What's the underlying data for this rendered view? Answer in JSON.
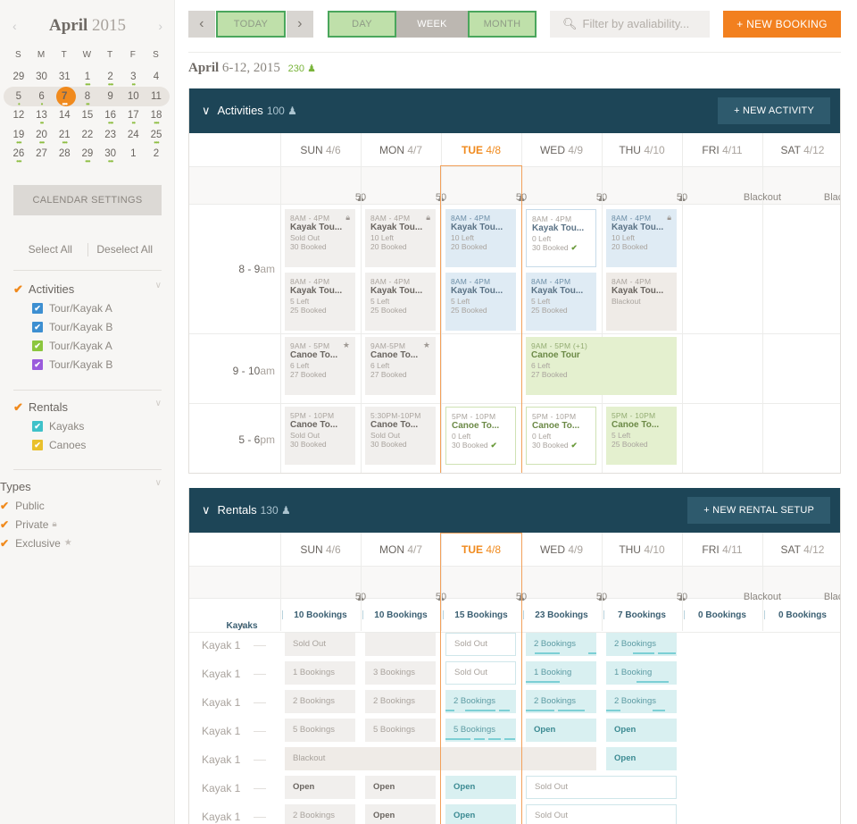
{
  "sidebar": {
    "calendar": {
      "month": "April",
      "year": "2015",
      "dow": [
        "S",
        "M",
        "T",
        "W",
        "T",
        "F",
        "S"
      ],
      "weeks": [
        [
          {
            "d": "29",
            "dim": true
          },
          {
            "d": "30",
            "dim": true
          },
          {
            "d": "31",
            "dim": true
          },
          {
            "d": "1",
            "dots": "•••"
          },
          {
            "d": "2",
            "dots": "•••"
          },
          {
            "d": "3",
            "dots": "••"
          },
          {
            "d": "4"
          }
        ],
        [
          {
            "d": "5",
            "dots": "•"
          },
          {
            "d": "6",
            "dots": "•"
          },
          {
            "d": "7",
            "today": true,
            "dots": "•••"
          },
          {
            "d": "8",
            "dots": "••"
          },
          {
            "d": "9",
            "dim": true
          },
          {
            "d": "10",
            "dim": true
          },
          {
            "d": "11",
            "dim": true
          }
        ],
        [
          {
            "d": "12"
          },
          {
            "d": "13",
            "dots": "••"
          },
          {
            "d": "14"
          },
          {
            "d": "15"
          },
          {
            "d": "16",
            "dots": "•••"
          },
          {
            "d": "17",
            "dots": "••"
          },
          {
            "d": "18",
            "dots": "•••"
          }
        ],
        [
          {
            "d": "19",
            "dots": "•••"
          },
          {
            "d": "20",
            "dots": "•••"
          },
          {
            "d": "21",
            "dots": "•••"
          },
          {
            "d": "22"
          },
          {
            "d": "23"
          },
          {
            "d": "24"
          },
          {
            "d": "25",
            "dots": "•••"
          }
        ],
        [
          {
            "d": "26",
            "dots": "•••"
          },
          {
            "d": "27"
          },
          {
            "d": "28"
          },
          {
            "d": "29",
            "dots": "•••"
          },
          {
            "d": "30",
            "dots": "•••"
          },
          {
            "d": "1",
            "dim": true
          },
          {
            "d": "2",
            "dim": true
          }
        ]
      ]
    },
    "settings_label": "CALENDAR SETTINGS",
    "select_all": "Select All",
    "deselect_all": "Deselect All",
    "groups": {
      "activities": {
        "label": "Activities",
        "items": [
          {
            "label": "Tour/Kayak A",
            "color": "#3d8fd1"
          },
          {
            "label": "Tour/Kayak B",
            "color": "#3d8fd1"
          },
          {
            "label": "Tour/Kayak A",
            "color": "#8cc63e"
          },
          {
            "label": "Tour/Kayak B",
            "color": "#9a5bdc"
          }
        ]
      },
      "rentals": {
        "label": "Rentals",
        "items": [
          {
            "label": "Kayaks",
            "color": "#3fc1c9"
          },
          {
            "label": "Canoes",
            "color": "#e9c02c"
          }
        ]
      },
      "types": {
        "label": "Types",
        "items": [
          {
            "label": "Public",
            "icon": ""
          },
          {
            "label": "Private",
            "icon": "lock-icon"
          },
          {
            "label": "Exclusive",
            "icon": "star-icon"
          }
        ]
      }
    }
  },
  "toolbar": {
    "today": "TODAY",
    "day": "DAY",
    "week": "WEEK",
    "month": "MONTH",
    "filter_placeholder": "Filter by avaliability...",
    "new_booking": "+ NEW BOOKING"
  },
  "range": {
    "month": "April",
    "days": "6-12, 2015",
    "count": "230"
  },
  "days": [
    {
      "dow": "SUN",
      "date": "4/6"
    },
    {
      "dow": "MON",
      "date": "4/7"
    },
    {
      "dow": "TUE",
      "date": "4/8"
    },
    {
      "dow": "WED",
      "date": "4/9"
    },
    {
      "dow": "THU",
      "date": "4/10"
    },
    {
      "dow": "FRI",
      "date": "4/11"
    },
    {
      "dow": "SAT",
      "date": "4/12"
    }
  ],
  "activities": {
    "title": "Activities",
    "count": "100",
    "button": "+ NEW ACTIVITY",
    "capacity": [
      "50",
      "50",
      "50",
      "50",
      "50",
      "Blackout",
      "Blackout"
    ],
    "times": [
      {
        "bold": "8 - 9",
        "suffix": "am"
      },
      {
        "bold": "9 - 10",
        "suffix": "am"
      },
      {
        "bold": "5 - 6",
        "suffix": "pm"
      }
    ],
    "cards": [
      {
        "col": 0,
        "row": 0,
        "style": "grey",
        "time": "8AM - 4PM",
        "name": "Kayak Tou...",
        "l1": "Sold Out",
        "l2": "30 Booked",
        "icon": "lock"
      },
      {
        "col": 1,
        "row": 0,
        "style": "grey",
        "time": "8AM - 4PM",
        "name": "Kayak Tou...",
        "l1": "10 Left",
        "l2": "20 Booked",
        "icon": "lock"
      },
      {
        "col": 2,
        "row": 0,
        "style": "blue",
        "time": "8AM - 4PM",
        "name": "Kayak Tou...",
        "l1": "10 Left",
        "l2": "20 Booked"
      },
      {
        "col": 3,
        "row": 0,
        "style": "bluebd",
        "time": "8AM - 4PM",
        "name": "Kayak Tou...",
        "l1": "0 Left",
        "l2": "30 Booked",
        "check": true
      },
      {
        "col": 4,
        "row": 0,
        "style": "blue",
        "time": "8AM - 4PM",
        "name": "Kayak Tou...",
        "l1": "10 Left",
        "l2": "20 Booked",
        "icon": "lock"
      },
      {
        "col": 0,
        "row": 1,
        "style": "grey",
        "time": "8AM - 4PM",
        "name": "Kayak Tou...",
        "l1": "5 Left",
        "l2": "25 Booked"
      },
      {
        "col": 1,
        "row": 1,
        "style": "grey",
        "time": "8AM - 4PM",
        "name": "Kayak Tou...",
        "l1": "5 Left",
        "l2": "25 Booked"
      },
      {
        "col": 2,
        "row": 1,
        "style": "blue",
        "time": "8AM - 4PM",
        "name": "Kayak Tou...",
        "l1": "5 Left",
        "l2": "25 Booked"
      },
      {
        "col": 3,
        "row": 1,
        "style": "blue",
        "time": "8AM - 4PM",
        "name": "Kayak Tou...",
        "l1": "5 Left",
        "l2": "25 Booked"
      },
      {
        "col": 4,
        "row": 1,
        "style": "beige",
        "time": "8AM - 4PM",
        "name": "Kayak Tou...",
        "l1": "Blackout",
        "l2": ""
      },
      {
        "col": 0,
        "row": 2,
        "style": "grey",
        "time": "9AM - 5PM",
        "name": "Canoe To...",
        "l1": "6 Left",
        "l2": "27 Booked",
        "icon": "star"
      },
      {
        "col": 1,
        "row": 2,
        "style": "grey",
        "time": "9AM-5PM",
        "name": "Canoe To...",
        "l1": "6 Left",
        "l2": "27 Booked",
        "icon": "star"
      },
      {
        "col": 3,
        "row": 2,
        "style": "green",
        "span": 2,
        "time": "9AM - 5PM (+1)",
        "name": "Canoe Tour",
        "l1": "6 Left",
        "l2": "27 Booked"
      },
      {
        "col": 0,
        "row": 3,
        "style": "grey",
        "time": "5PM - 10PM",
        "name": "Canoe To...",
        "l1": "Sold Out",
        "l2": "30 Booked"
      },
      {
        "col": 1,
        "row": 3,
        "style": "grey",
        "time": "5:30PM-10PM",
        "name": "Canoe To...",
        "l1": "Sold Out",
        "l2": "30 Booked"
      },
      {
        "col": 2,
        "row": 3,
        "style": "greenbd",
        "time": "5PM - 10PM",
        "name": "Canoe To...",
        "l1": "0 Left",
        "l2": "30 Booked",
        "check": true
      },
      {
        "col": 3,
        "row": 3,
        "style": "greenbd",
        "time": "5PM - 10PM",
        "name": "Canoe To...",
        "l1": "0 Left",
        "l2": "30 Booked",
        "check": true
      },
      {
        "col": 4,
        "row": 3,
        "style": "green",
        "time": "5PM - 10PM",
        "name": "Canoe To...",
        "l1": "5 Left",
        "l2": "25 Booked"
      }
    ]
  },
  "rentals": {
    "title": "Rentals",
    "count": "130",
    "button": "+ NEW RENTAL SETUP",
    "capacity": [
      "50",
      "50",
      "50",
      "50",
      "50",
      "Blackout",
      "Blackout"
    ],
    "group_label": "Kayaks",
    "summary": [
      "10 Bookings",
      "10 Bookings",
      "15 Bookings",
      "23 Bookings",
      "7 Bookings",
      "0 Bookings",
      "0 Bookings"
    ],
    "rows": [
      {
        "label": "Kayak 1",
        "cells": [
          {
            "col": 0,
            "s": "g",
            "t": "Sold Out"
          },
          {
            "col": 1,
            "s": "g",
            "t": ""
          },
          {
            "col": 2,
            "s": "w",
            "t": "Sold Out"
          },
          {
            "col": 3,
            "s": "t",
            "t": "2 Bookings",
            "bars": [
              [
                10,
                28
              ],
              [
                70,
                14
              ]
            ]
          },
          {
            "col": 4,
            "s": "t",
            "t": "2 Bookings",
            "bars": [
              [
                30,
                24
              ],
              [
                58,
                20
              ]
            ]
          }
        ]
      },
      {
        "label": "Kayak 1",
        "cells": [
          {
            "col": 0,
            "s": "g",
            "t": "1 Bookings"
          },
          {
            "col": 1,
            "s": "g",
            "t": "3 Bookings"
          },
          {
            "col": 2,
            "s": "w",
            "t": "Sold Out"
          },
          {
            "col": 3,
            "s": "t",
            "t": "1 Booking",
            "bars": [
              [
                0,
                38
              ]
            ]
          },
          {
            "col": 4,
            "s": "t",
            "t": "1 Booking",
            "bars": [
              [
                34,
                36
              ]
            ]
          }
        ]
      },
      {
        "label": "Kayak 1",
        "cells": [
          {
            "col": 0,
            "s": "g",
            "t": "2 Bookings"
          },
          {
            "col": 1,
            "s": "g",
            "t": "2 Bookings"
          },
          {
            "col": 2,
            "s": "t",
            "t": "2 Bookings",
            "bars": [
              [
                0,
                10
              ],
              [
                22,
                34
              ],
              [
                60,
                12
              ]
            ]
          },
          {
            "col": 3,
            "s": "t",
            "t": "2 Bookings",
            "bars": [
              [
                0,
                32
              ],
              [
                36,
                30
              ]
            ]
          },
          {
            "col": 4,
            "s": "t",
            "t": "2 Bookings",
            "bars": [
              [
                0,
                16
              ],
              [
                52,
                14
              ]
            ]
          }
        ]
      },
      {
        "label": "Kayak 1",
        "cells": [
          {
            "col": 0,
            "s": "g",
            "t": "5 Bookings"
          },
          {
            "col": 1,
            "s": "g",
            "t": "5 Bookings"
          },
          {
            "col": 2,
            "s": "t",
            "t": "5 Bookings",
            "bars": [
              [
                0,
                28
              ],
              [
                32,
                12
              ],
              [
                48,
                14
              ],
              [
                66,
                12
              ]
            ]
          },
          {
            "col": 3,
            "s": "t",
            "t": "Open",
            "open": true
          },
          {
            "col": 4,
            "s": "t",
            "t": "Open",
            "open": true
          }
        ]
      },
      {
        "label": "Kayak 1",
        "cells": [
          {
            "col": 0,
            "s": "b",
            "t": "Blackout",
            "span": 4
          },
          {
            "col": 4,
            "s": "t",
            "t": "Open",
            "open": true
          }
        ]
      },
      {
        "label": "Kayak 1",
        "cells": [
          {
            "col": 0,
            "s": "g",
            "t": "Open",
            "open": true
          },
          {
            "col": 1,
            "s": "g",
            "t": "Open",
            "open": true
          },
          {
            "col": 2,
            "s": "t",
            "t": "Open",
            "open": true
          },
          {
            "col": 3,
            "s": "w",
            "t": "Sold Out",
            "span": 2
          }
        ]
      },
      {
        "label": "Kayak 1",
        "cells": [
          {
            "col": 0,
            "s": "g",
            "t": "2 Bookings"
          },
          {
            "col": 1,
            "s": "g",
            "t": "Open",
            "open": true
          },
          {
            "col": 2,
            "s": "t",
            "t": "Open",
            "open": true
          },
          {
            "col": 3,
            "s": "w",
            "t": "Sold Out",
            "span": 2
          }
        ]
      }
    ]
  }
}
